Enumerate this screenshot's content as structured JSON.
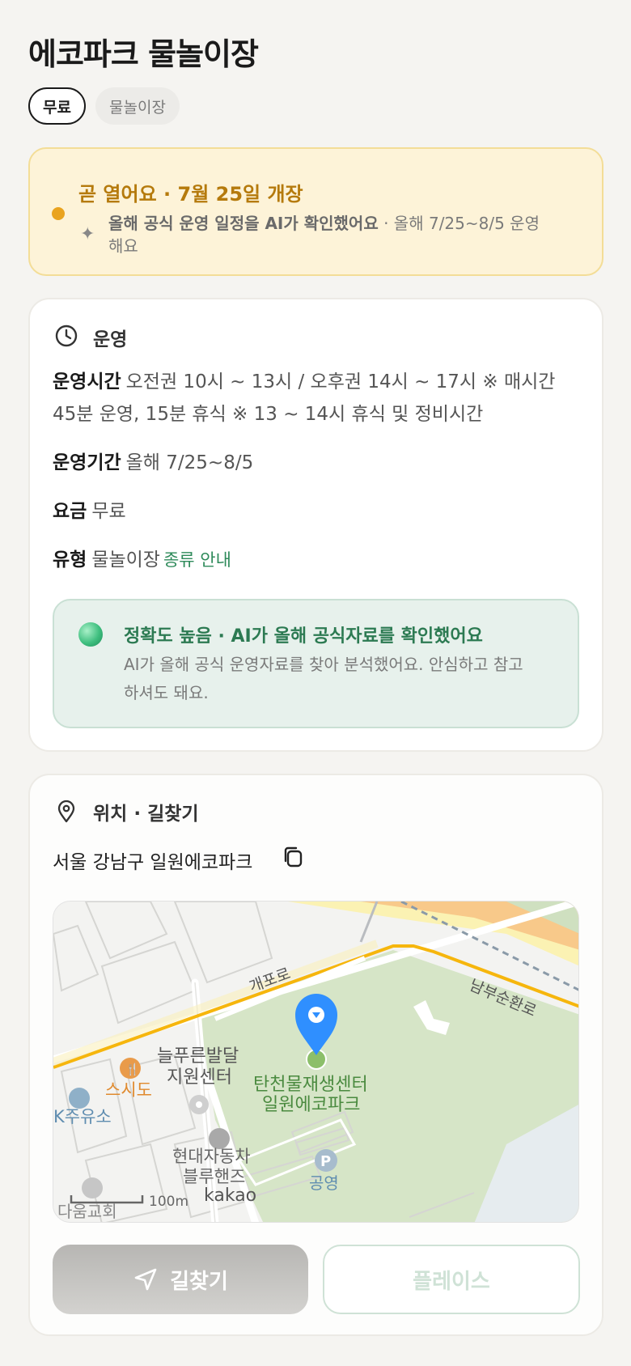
{
  "page": {
    "title": "에코파크 물놀이장",
    "chips": {
      "price": "무료",
      "type": "물놀이장"
    }
  },
  "notice": {
    "headline": "곧 열어요 · 7월 25일 개장",
    "ai_check": "올해 공식 운영 일정을 AI가 확인했어요",
    "detail": " · 올해 7/25~8/5 운영해요",
    "accent_color": "#e9a31f"
  },
  "operation": {
    "section_title": "운영",
    "hours_label": "운영시간",
    "hours_value": "오전권 10시 ~ 13시 / 오후권 14시 ~ 17시 ※ 매시간 45분 운영, 15분 휴식 ※ 13 ~ 14시 휴식 및 정비시간",
    "period_label": "운영기간",
    "period_value": "올해 7/25~8/5",
    "fee_label": "요금",
    "fee_value": "무료",
    "type_label": "유형",
    "type_value": "물놀이장",
    "type_link": "종류 안내",
    "accuracy": {
      "headline": "정확도 높음 · AI가 올해 공식자료를 확인했어요",
      "body": "AI가 올해 공식 운영자료를 찾아 분석했어요. 안심하고 참고하셔도 돼요."
    }
  },
  "location": {
    "section_title": "위치 · 길찾기",
    "address": "서울 강남구 일원에코파크",
    "map": {
      "labels": {
        "road_gaepo": "개포로",
        "road_nambu": "남부순환로",
        "center": "늘푸른발달",
        "center2": "지원센터",
        "place_name1": "탄천물재생센터",
        "place_name2": "일원에코파크",
        "restaurant": "스시도",
        "gas": "K주유소",
        "shop1": "현대자동차",
        "shop2": "블루핸즈",
        "church": "다움교회",
        "parking": "공영",
        "parking_icon": "P",
        "scale": "100m",
        "brand": "kakao"
      }
    },
    "buttons": {
      "directions": "길찾기",
      "place": "플레이스"
    }
  }
}
